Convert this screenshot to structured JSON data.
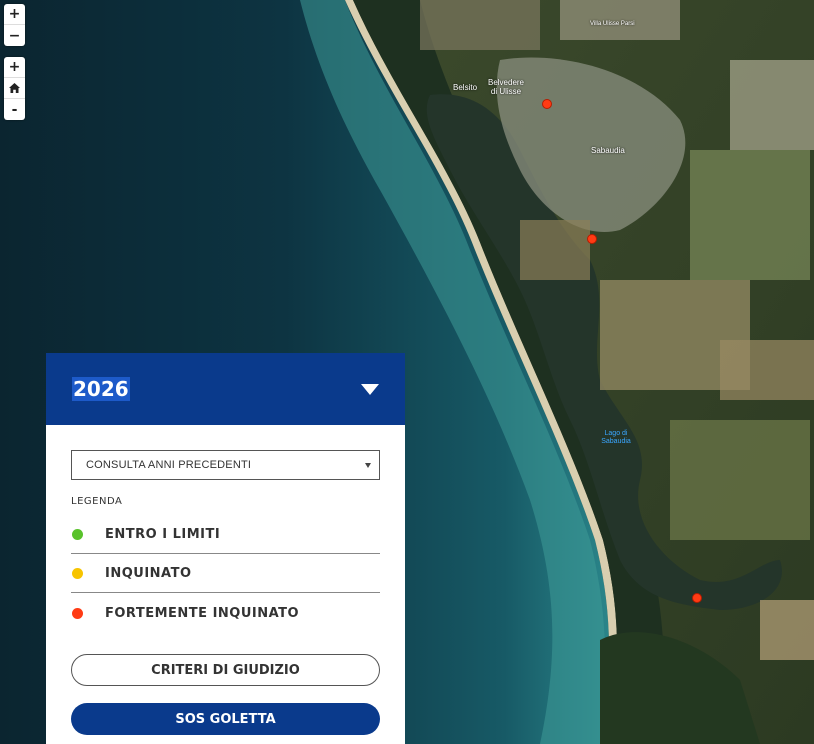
{
  "map": {
    "zoom_controls": {
      "zoom_in": "+",
      "zoom_out": "−"
    },
    "nav_controls": {
      "zoom_in": "+",
      "home_icon": "home-icon",
      "zoom_out": "-"
    },
    "place_labels": [
      "Belvedere di Ulisse",
      "Belsito",
      "Sabaudia",
      "Villa Ulisse Parsi"
    ],
    "lake_label": "Lago di Sabaudia",
    "marker_color": "#ff3b14",
    "marker_status": "FORTEMENTE INQUINATO"
  },
  "panel": {
    "year": "2026",
    "header_color": "#0a3a8c",
    "select": {
      "label": "CONSULTA ANNI PRECEDENTI"
    },
    "legend": {
      "title": "LEGENDA",
      "items": [
        {
          "label": "ENTRO I LIMITI",
          "color": "#59c22b"
        },
        {
          "label": "INQUINATO",
          "color": "#f7c400"
        },
        {
          "label": "FORTEMENTE INQUINATO",
          "color": "#ff3b14"
        }
      ]
    },
    "criteri_label": "CRITERI DI GIUDIZIO",
    "sos_label": "SOS GOLETTA"
  }
}
